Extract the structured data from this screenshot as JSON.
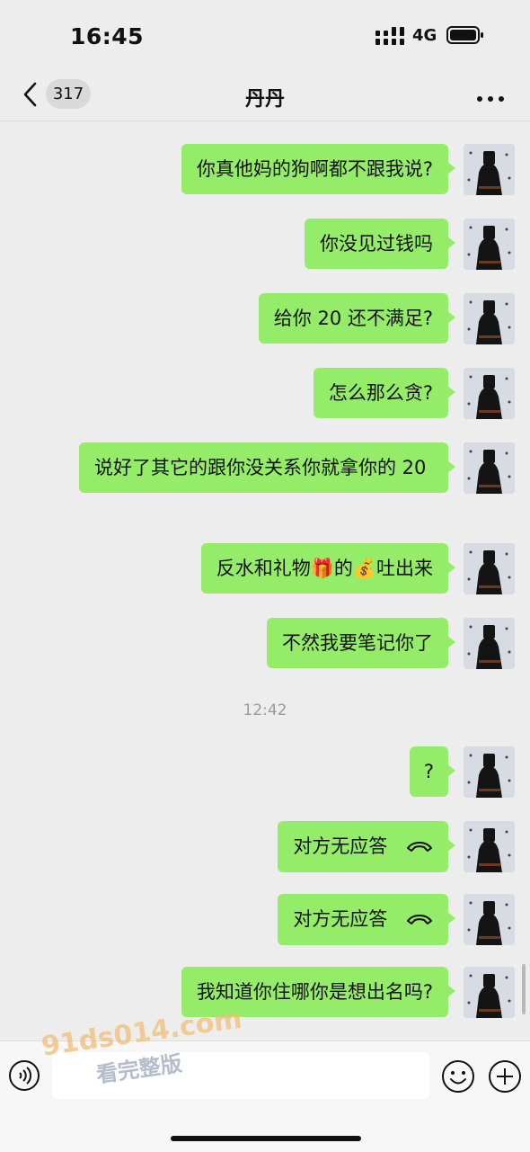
{
  "status_bar": {
    "time": "16:45",
    "network": "4G"
  },
  "nav": {
    "back_count": "317",
    "title": "丹丹"
  },
  "messages": [
    {
      "text": "你真他妈的狗啊都不跟我说?"
    },
    {
      "text": "你没见过钱吗"
    },
    {
      "text": "给你 20 还不满足?"
    },
    {
      "text": "怎么那么贪?"
    },
    {
      "text": "说好了其它的跟你没关系你就拿你的 20"
    },
    {
      "text": "反水和礼物🎁的💰吐出来"
    },
    {
      "text": "不然我要笔记你了"
    },
    {
      "text": "?"
    },
    {
      "text": "对方无应答",
      "icon": "phone-hangup-icon"
    },
    {
      "text": "对方无应答",
      "icon": "phone-hangup-icon"
    },
    {
      "text": "我知道你住哪你是想出名吗?"
    }
  ],
  "timestamp": "12:42",
  "watermark": {
    "url": "91ds014.com",
    "sub": "看完整版"
  },
  "colors": {
    "bubble": "#95ec69",
    "background": "#ededed"
  }
}
